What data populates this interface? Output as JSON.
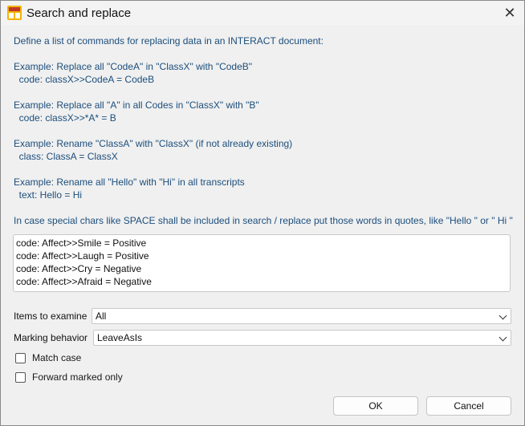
{
  "window": {
    "title": "Search and replace"
  },
  "instructions": {
    "intro": "Define a list of commands for replacing data in an INTERACT document:",
    "ex1_title": "Example: Replace all \"CodeA\" in \"ClassX\" with \"CodeB\"",
    "ex1_code": "  code: classX>>CodeA = CodeB",
    "ex2_title": "Example: Replace all \"A\" in all Codes in \"ClassX\" with \"B\"",
    "ex2_code": "  code: classX>>*A* = B",
    "ex3_title": "Example: Rename \"ClassA\" with \"ClassX\" (if not already existing)",
    "ex3_code": "  class: ClassA = ClassX",
    "ex4_title": "Example: Rename all \"Hello\" with \"Hi\" in all transcripts",
    "ex4_code": "  text: Hello = Hi",
    "special": "In case special chars like SPACE shall be included in search / replace put those words in quotes, like \"Hello \" or \" Hi \""
  },
  "commands": [
    "code: Affect>>Smile = Positive",
    "code: Affect>>Laugh = Positive",
    "code: Affect>>Cry = Negative",
    "code: Affect>>Afraid = Negative"
  ],
  "items_to_examine": {
    "label": "Items to examine",
    "value": "All"
  },
  "marking_behavior": {
    "label": "Marking behavior",
    "value": "LeaveAsIs"
  },
  "match_case": {
    "label": "Match case",
    "checked": false
  },
  "forward_marked_only": {
    "label": "Forward marked only",
    "checked": false
  },
  "buttons": {
    "ok": "OK",
    "cancel": "Cancel"
  }
}
